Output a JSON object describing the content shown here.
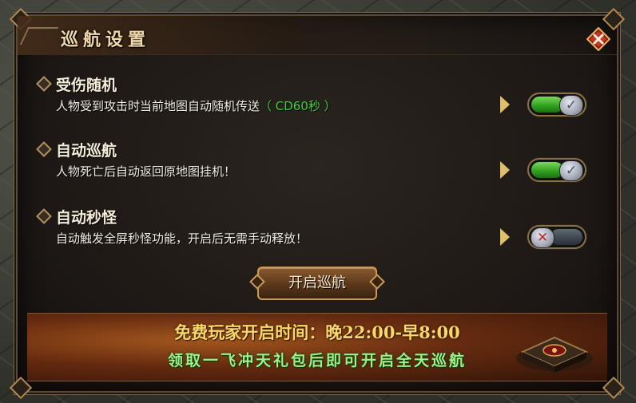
{
  "dialog": {
    "title": "巡航设置"
  },
  "options": [
    {
      "name": "受伤随机",
      "desc": "人物受到攻击时当前地图自动随机传送",
      "cd": "（ CD60秒 ）",
      "enabled": true
    },
    {
      "name": "自动巡航",
      "desc": "人物死亡后自动返回原地图挂机！",
      "cd": "",
      "enabled": true
    },
    {
      "name": "自动秒怪",
      "desc": "自动触发全屏秒怪功能，开启后无需手动释放！",
      "cd": "",
      "enabled": false
    }
  ],
  "toggle_marks": {
    "on": "✓",
    "off": "✕"
  },
  "start_button": {
    "label": "开启巡航"
  },
  "banner": {
    "line1": "免费玩家开启时间：晚22:00-早8:00",
    "line2": "领取一飞冲天礼包后即可开启全天巡航"
  },
  "colors": {
    "title": "#f0d8a8",
    "cd_green": "#3fcf3a",
    "banner_gold": "#f7d86c",
    "banner_green": "#9ff08a"
  }
}
